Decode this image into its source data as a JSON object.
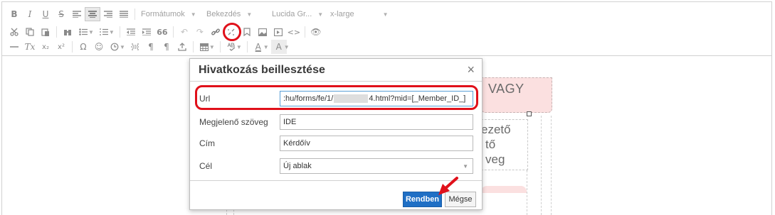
{
  "toolbar": {
    "row1": {
      "bold": "B",
      "italic": "I",
      "underline": "U",
      "strike": "S",
      "format_combo": "Formátumok",
      "paragraph_combo": "Bekezdés",
      "font_combo": "Lucida Gr...",
      "size_combo": "x-large"
    },
    "row2": {
      "quote": "66",
      "view": "👁"
    },
    "row3": {
      "remove_format": "Tx",
      "subscript": "x₂",
      "superscript": "x²",
      "omega": "Ω",
      "smile": "☺",
      "pilcrow1": "¶",
      "pilcrow2": "¶",
      "font_color": "A",
      "bg_color": "A"
    }
  },
  "content": {
    "vagy_text": "VAGY",
    "side_lines": [
      "ezető",
      "tő",
      "veg"
    ]
  },
  "dialog": {
    "title": "Hivatkozás beillesztése",
    "close": "×",
    "fields": {
      "url_label": "Url",
      "url_value_start": ":hu/forms/fe/1/",
      "url_value_end": "4.html?mid=[_Member_ID_]",
      "text_label": "Megjelenő szöveg",
      "text_value": "IDE",
      "title_label": "Cím",
      "title_value": "Kérdőív",
      "target_label": "Cél",
      "target_value": "Új ablak"
    },
    "ok_label": "Rendben",
    "cancel_label": "Mégse"
  },
  "colors": {
    "highlight": "#e0101a",
    "ok_button": "#1f6fc5",
    "pink_box": "#fbe0e0"
  }
}
